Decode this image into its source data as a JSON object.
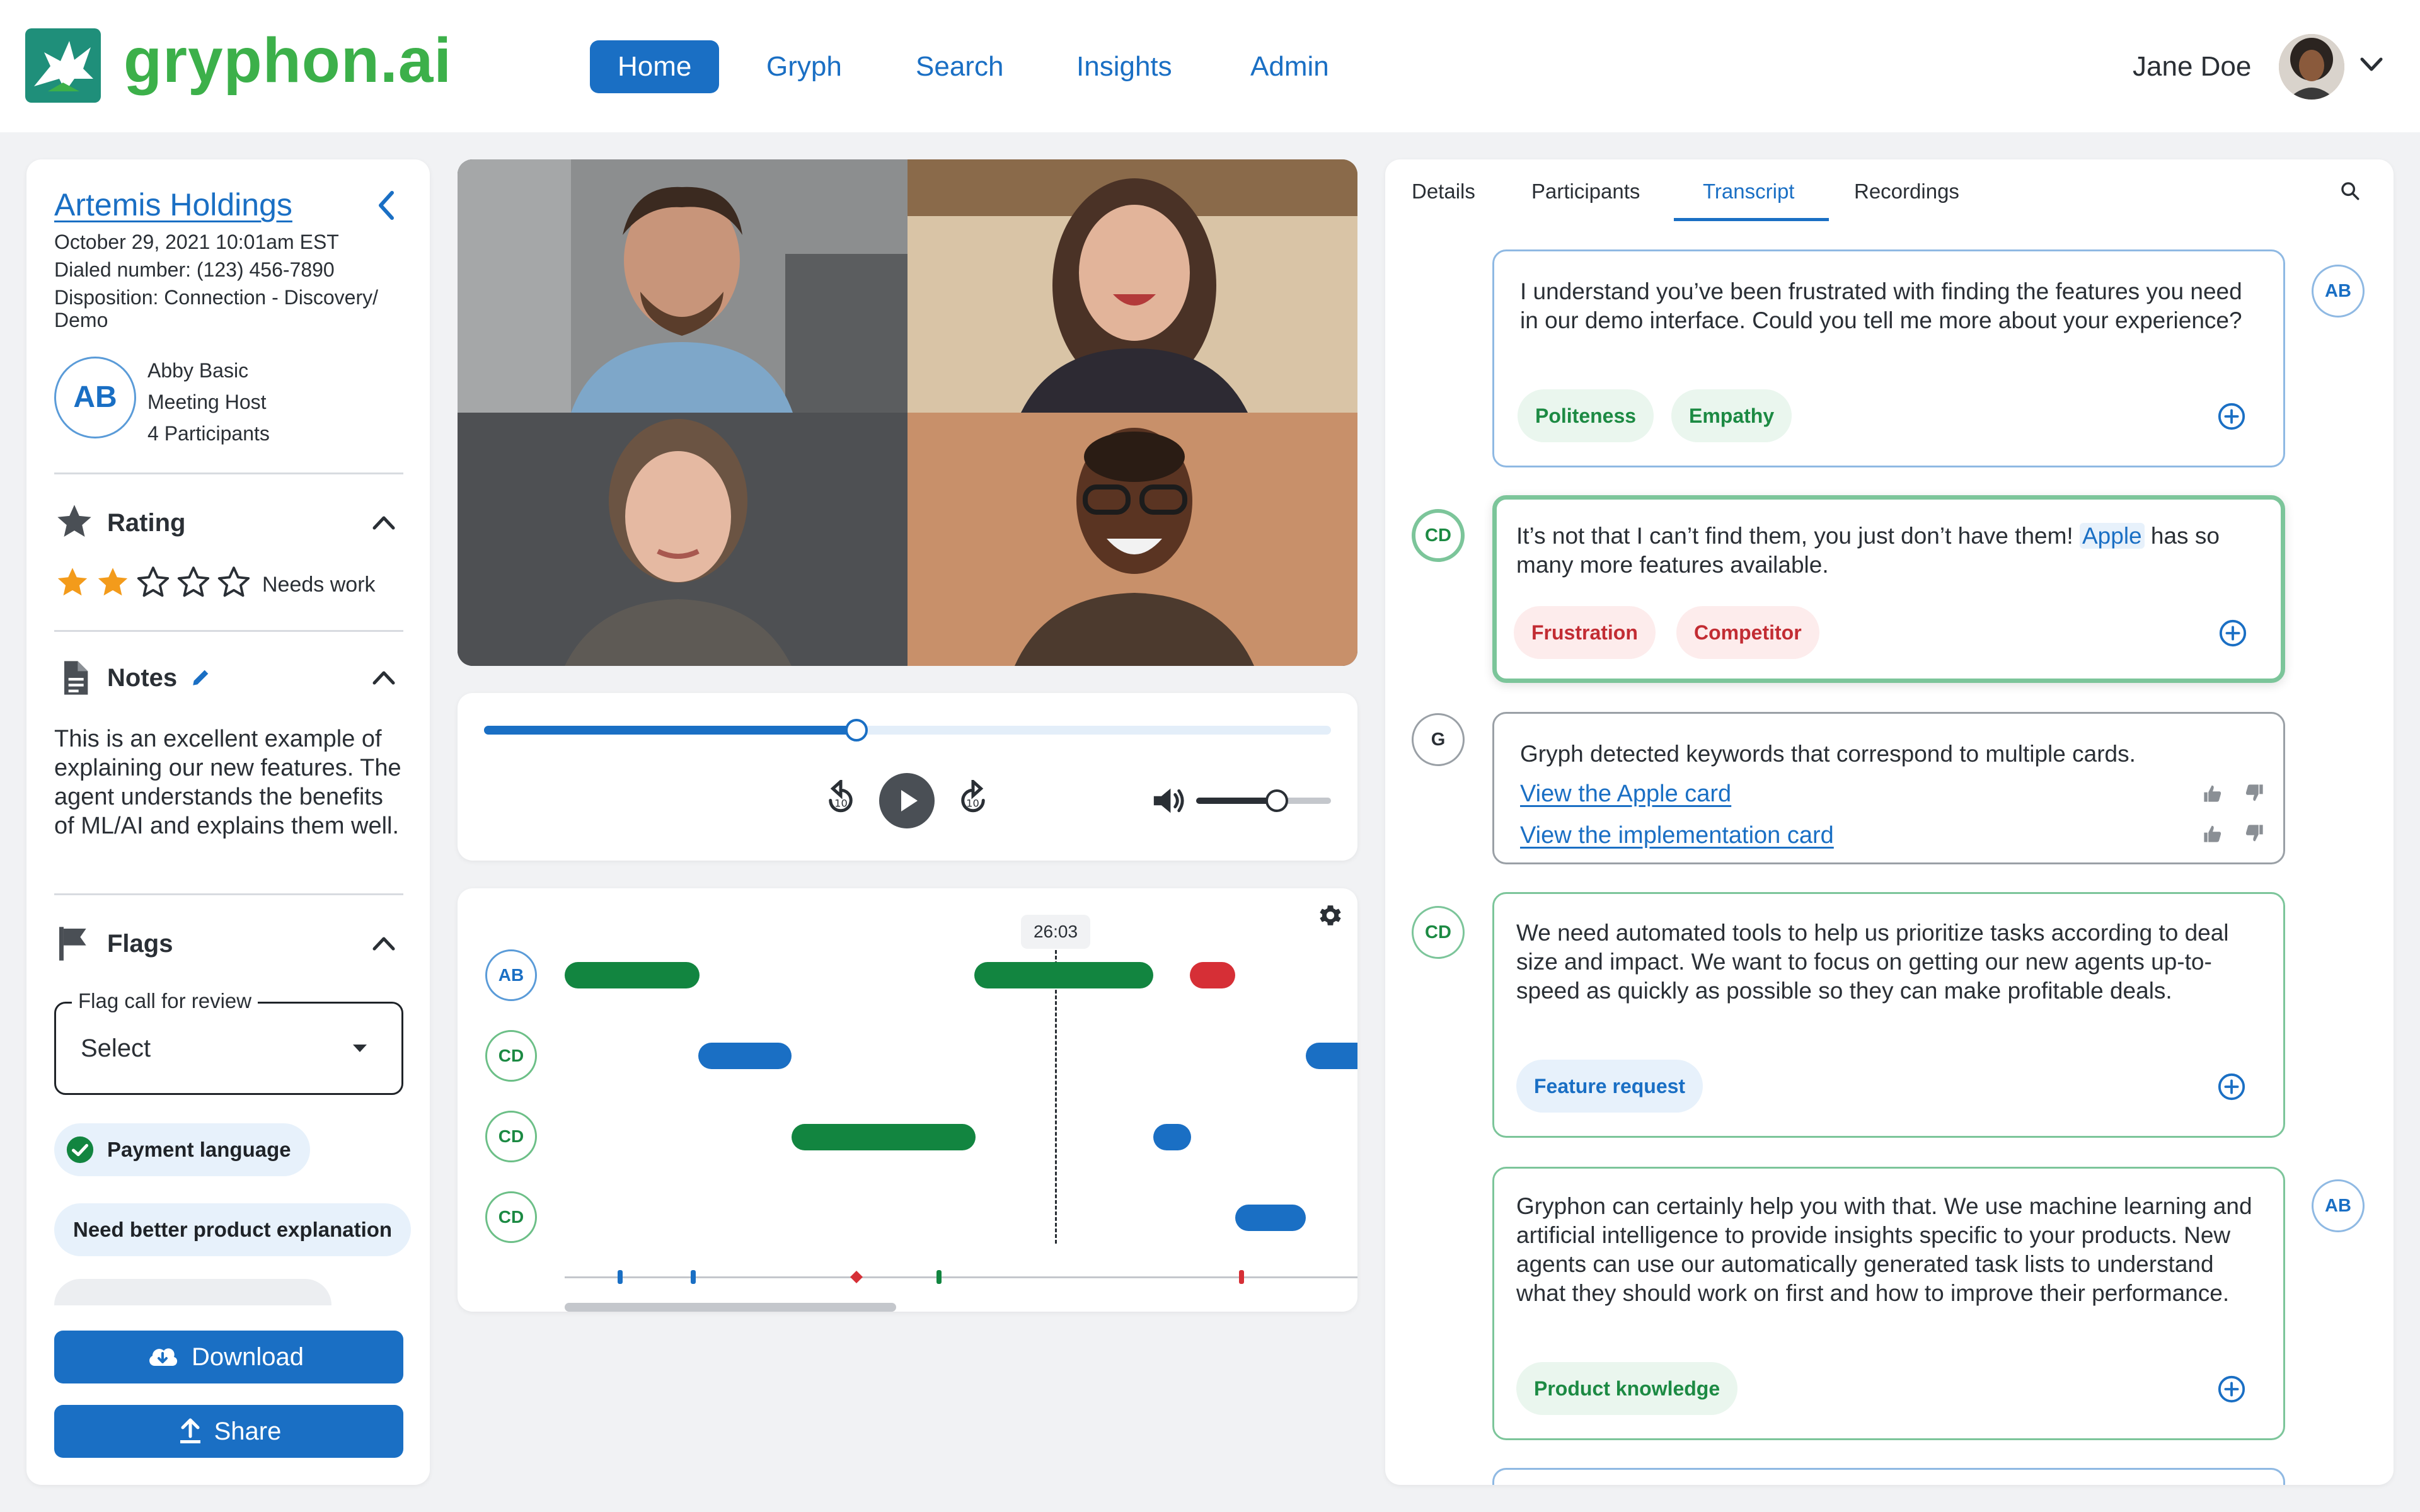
{
  "brand": {
    "name": "gryphon.ai",
    "color": "#3cb04a"
  },
  "nav": {
    "items": [
      {
        "label": "Home",
        "active": true
      },
      {
        "label": "Gryph"
      },
      {
        "label": "Search"
      },
      {
        "label": "Insights"
      },
      {
        "label": "Admin"
      }
    ]
  },
  "user": {
    "name": "Jane Doe"
  },
  "call": {
    "account": "Artemis Holdings",
    "datetime": "October 29, 2021 10:01am EST",
    "dialed": "Dialed number: (123) 456-7890",
    "disposition_1": "Disposition: Connection - Discovery/",
    "disposition_2": "Demo",
    "host": {
      "initials": "AB",
      "name": "Abby Basic",
      "role": "Meeting Host",
      "participants": "4 Participants"
    }
  },
  "rating": {
    "title": "Rating",
    "value": 2,
    "max": 5,
    "label": "Needs work"
  },
  "notes": {
    "title": "Notes",
    "text": "This is an excellent example of explaining our new features. The agent understands the benefits of ML/AI and explains them well."
  },
  "flags": {
    "title": "Flags",
    "field_label": "Flag call for review",
    "field_value": "Select",
    "chips": [
      "Payment language",
      "Need better product explanation"
    ]
  },
  "actions": {
    "download": "Download",
    "share": "Share"
  },
  "player": {
    "progress": 0.44,
    "volume": 0.6
  },
  "speaker_timeline": {
    "current_time": "26:03",
    "speakers": [
      "AB",
      "CD",
      "CD",
      "CD"
    ]
  },
  "transcript": {
    "tabs": [
      "Details",
      "Participants",
      "Transcript",
      "Recordings"
    ],
    "active_tab": "Transcript",
    "entries": [
      {
        "speaker": "AB",
        "text": "I understand you’ve been frustrated with finding the features you need in our demo interface. Could you tell me more about your experience?",
        "tags": [
          "Politeness",
          "Empathy"
        ]
      },
      {
        "speaker": "CD",
        "text_before": "It’s not that I can’t find them, you just don’t have them! ",
        "text_highlight": "Apple",
        "text_after": " has so many more features available.",
        "tags": [
          "Frustration",
          "Competitor"
        ]
      },
      {
        "speaker": "G",
        "text": "Gryph detected keywords that correspond to multiple cards.",
        "links": [
          "View the Apple card",
          "View the implementation card"
        ]
      },
      {
        "speaker": "CD",
        "text": "We need automated tools to help us prioritize tasks according to deal size and impact. We want to focus on getting our new agents up-to-speed as quickly as possible so they can make profitable deals.",
        "tags": [
          "Feature request"
        ]
      },
      {
        "speaker": "AB",
        "text": "Gryphon can certainly help you with that. We use machine learning and artificial intelligence to provide insights specific to your products. New agents can use our automatically generated task lists to understand what they should work on first and how to improve their performance.",
        "tags": [
          "Product knowledge"
        ]
      }
    ]
  },
  "colors": {
    "primary": "#1a6fc4",
    "green": "#128540",
    "red": "#d62f36",
    "star": "#f39b1b"
  }
}
